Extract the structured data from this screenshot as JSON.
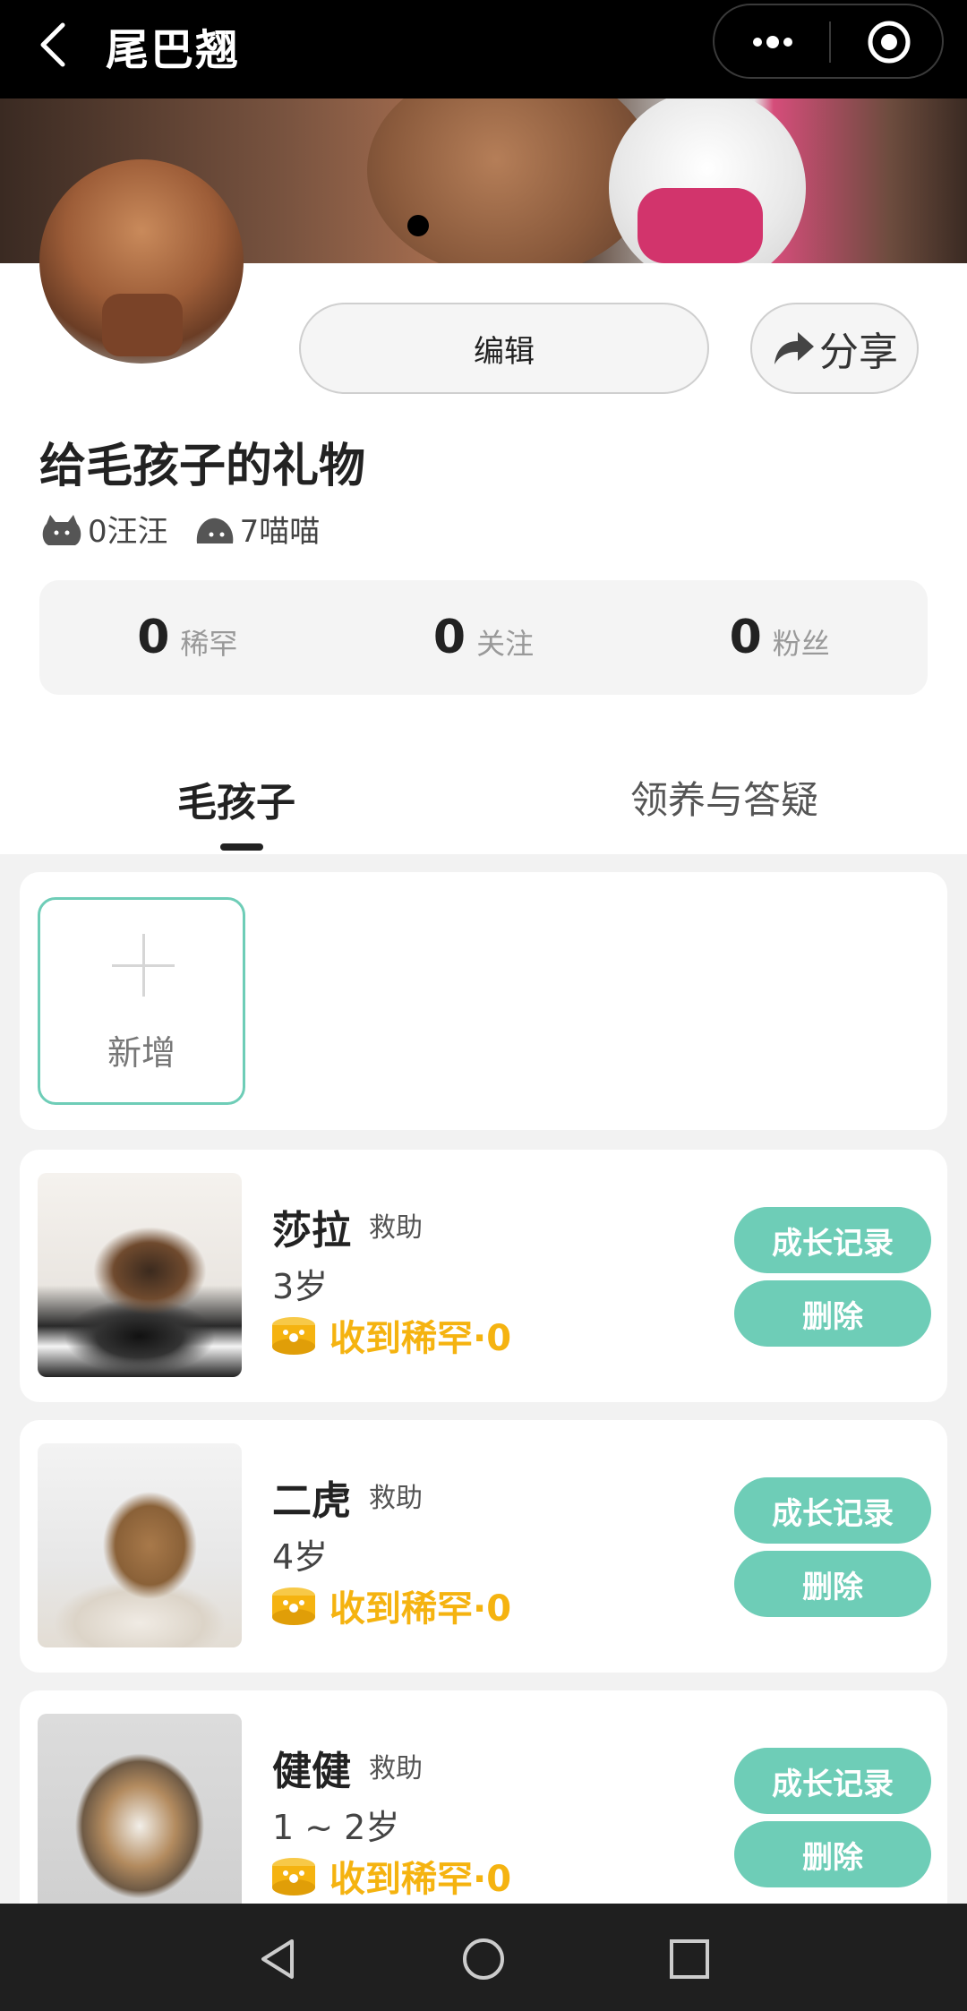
{
  "app": {
    "title": "尾巴翘"
  },
  "profile": {
    "edit_label": "编辑",
    "share_label": "分享",
    "name": "给毛孩子的礼物",
    "dog_count_label": "0汪汪",
    "cat_count_label": "7喵喵"
  },
  "stats": [
    {
      "value": "0",
      "label": "稀罕"
    },
    {
      "value": "0",
      "label": "关注"
    },
    {
      "value": "0",
      "label": "粉丝"
    }
  ],
  "tabs": {
    "pets": "毛孩子",
    "adopt": "领养与答疑"
  },
  "add_card": {
    "label": "新增"
  },
  "pets": [
    {
      "name": "莎拉",
      "tag": "救助",
      "age": "3岁",
      "rare": "收到稀罕·0",
      "growth_label": "成长记录",
      "delete_label": "删除"
    },
    {
      "name": "二虎",
      "tag": "救助",
      "age": "4岁",
      "rare": "收到稀罕·0",
      "growth_label": "成长记录",
      "delete_label": "删除"
    },
    {
      "name": "健健",
      "tag": "救助",
      "age": "1 ~ 2岁",
      "rare": "收到稀罕·0",
      "growth_label": "成长记录",
      "delete_label": "删除"
    }
  ],
  "colors": {
    "accent": "#6ecdb7",
    "rare": "#f5b310",
    "topbar": "#000000"
  }
}
